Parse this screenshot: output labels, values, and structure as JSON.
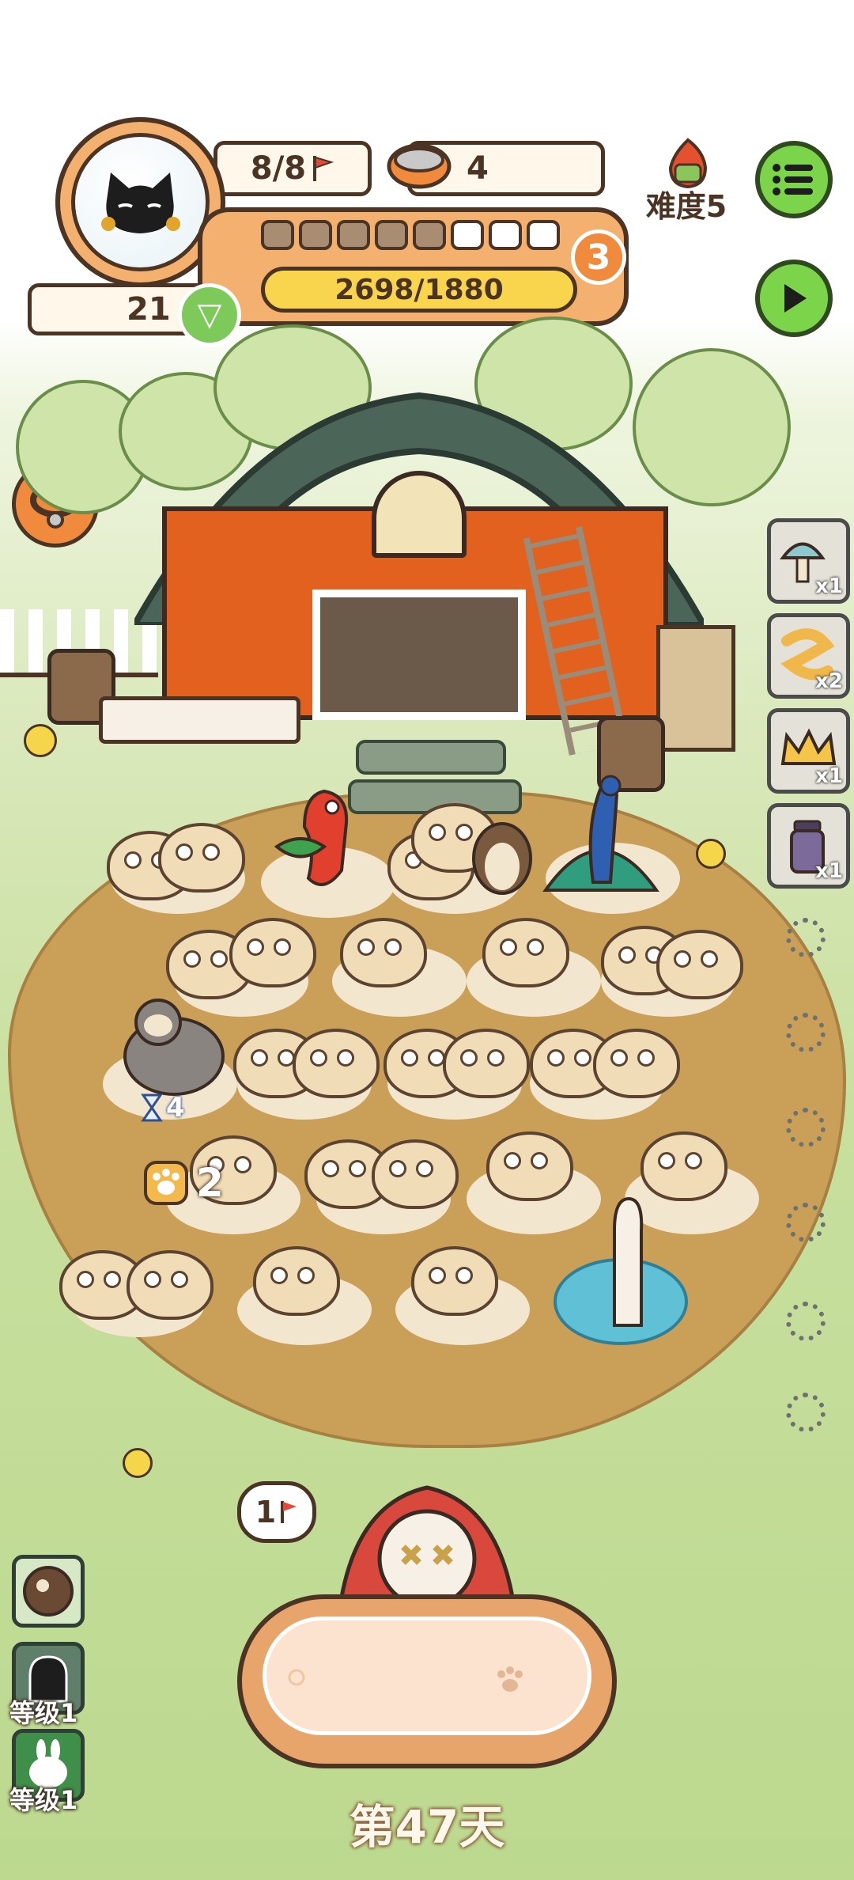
{
  "hud": {
    "capacity": "8/8",
    "food_count": "4",
    "difficulty": "难度5",
    "xp_progress": "2698/1880",
    "level": "3",
    "hearts": "21",
    "segments_filled": 5,
    "segments_total": 8
  },
  "sloth_timer": "4",
  "paw_count": "2",
  "speech_bubble": "1",
  "items": [
    {
      "icon": "mushroom-icon",
      "count": "x1"
    },
    {
      "icon": "worm-icon",
      "count": "x2"
    },
    {
      "icon": "crown-icon",
      "count": "x1"
    },
    {
      "icon": "jar-icon",
      "count": "x1"
    }
  ],
  "side_buttons": [
    {
      "icon": "coconut-icon",
      "label": ""
    },
    {
      "icon": "ghost-icon",
      "label": "等级1"
    },
    {
      "icon": "bunny-icon",
      "label": "等级1"
    }
  ],
  "day_label": "第47天",
  "colors": {
    "accent_orange": "#f4b06e",
    "green_button": "#7cd44b",
    "outline": "#4b3423"
  }
}
